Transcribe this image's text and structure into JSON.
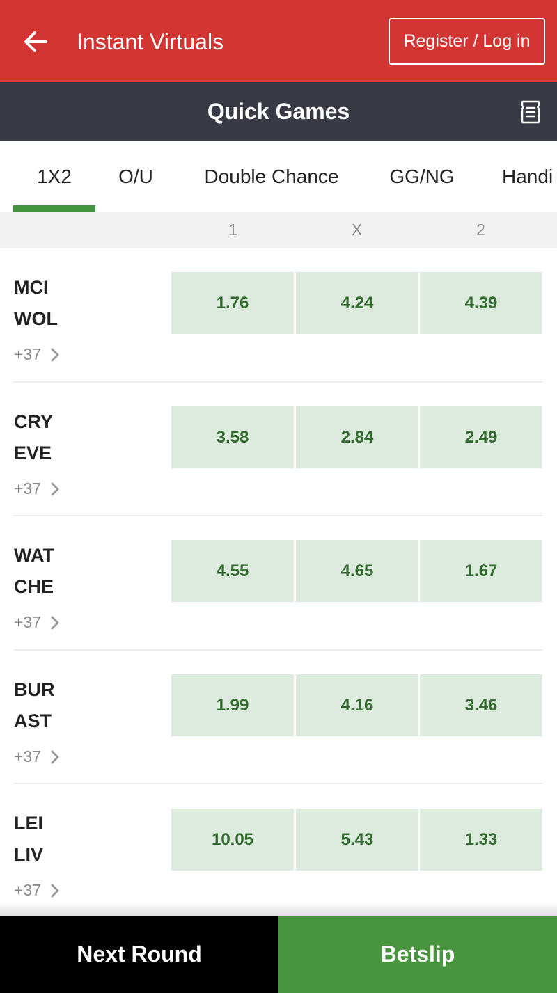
{
  "header": {
    "title": "Instant Virtuals",
    "login_label": "Register / Log in",
    "back_icon": "arrow-left-icon"
  },
  "section": {
    "title": "Quick Games",
    "receipt_icon": "receipt-icon"
  },
  "tabs": [
    {
      "label": "1X2",
      "active": true
    },
    {
      "label": "O/U",
      "active": false
    },
    {
      "label": "Double Chance",
      "active": false
    },
    {
      "label": "GG/NG",
      "active": false
    },
    {
      "label": "Handi",
      "active": false
    }
  ],
  "columns": [
    "1",
    "X",
    "2"
  ],
  "matches": [
    {
      "home": "MCI",
      "away": "WOL",
      "more": "+37",
      "odds": [
        "1.76",
        "4.24",
        "4.39"
      ]
    },
    {
      "home": "CRY",
      "away": "EVE",
      "more": "+37",
      "odds": [
        "3.58",
        "2.84",
        "2.49"
      ]
    },
    {
      "home": "WAT",
      "away": "CHE",
      "more": "+37",
      "odds": [
        "4.55",
        "4.65",
        "1.67"
      ]
    },
    {
      "home": "BUR",
      "away": "AST",
      "more": "+37",
      "odds": [
        "1.99",
        "4.16",
        "3.46"
      ]
    },
    {
      "home": "LEI",
      "away": "LIV",
      "more": "+37",
      "odds": [
        "10.05",
        "5.43",
        "1.33"
      ]
    }
  ],
  "bottom": {
    "next_round_label": "Next Round",
    "betslip_label": "Betslip"
  },
  "colors": {
    "header_red": "#d33533",
    "section_dark": "#383b45",
    "accent_green": "#43953f",
    "odd_bg": "#dcebdd",
    "odd_text": "#326b2e"
  }
}
